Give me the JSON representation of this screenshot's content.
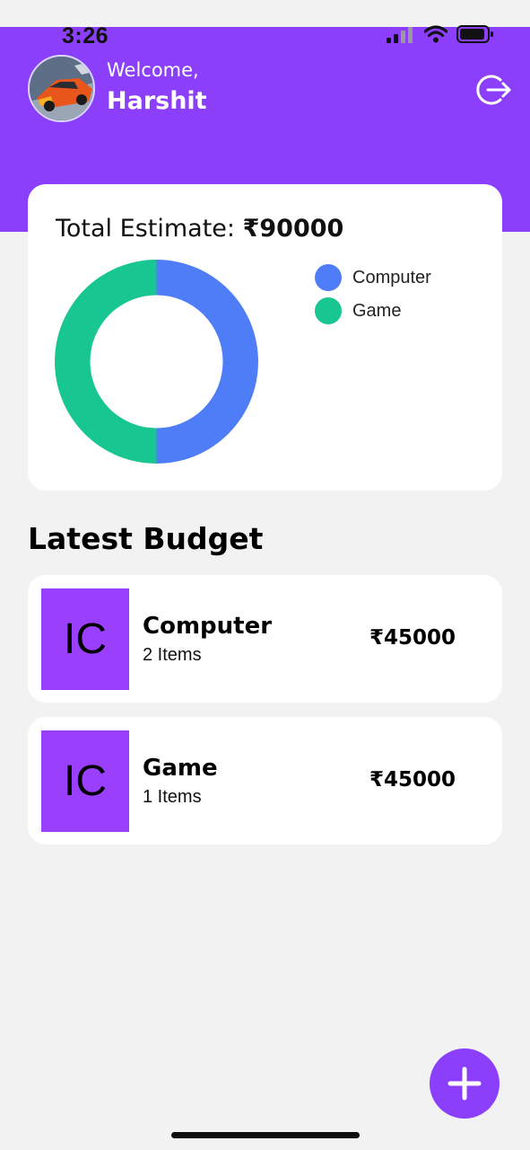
{
  "status_bar": {
    "time": "3:26",
    "icons": [
      "signal-icon",
      "wifi-icon",
      "battery-icon"
    ]
  },
  "header": {
    "welcome": "Welcome,",
    "user_name": "Harshit",
    "avatar_icon": "avatar-car-image",
    "logout_icon": "logout-icon"
  },
  "estimate": {
    "label": "Total Estimate: ",
    "total": "₹90000"
  },
  "chart_data": {
    "type": "pie",
    "categories": [
      "Computer",
      "Game"
    ],
    "values": [
      45000,
      45000
    ],
    "colors": [
      "#4f7cf7",
      "#17c690"
    ],
    "legend_placement": "right"
  },
  "latest_budget": {
    "title": "Latest Budget",
    "items": [
      {
        "icon_text": "IC",
        "name": "Computer",
        "count": "2 Items",
        "amount": "₹45000"
      },
      {
        "icon_text": "IC",
        "name": "Game",
        "count": "1 Items",
        "amount": "₹45000"
      }
    ]
  },
  "fab": {
    "icon": "plus-icon"
  },
  "colors": {
    "accent": "#8c3ffa",
    "thumb": "#9a3ffb",
    "background": "#f2f2f2"
  }
}
